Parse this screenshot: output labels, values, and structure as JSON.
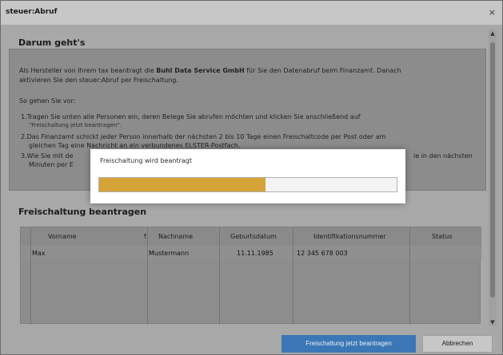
{
  "window": {
    "title": "steuer:Abruf",
    "close_glyph": "×"
  },
  "intro": {
    "heading": "Darum geht's",
    "paragraph_pre": "Als Hersteller von Ihrem tax beantragt die ",
    "paragraph_bold": "Buhl Data Service GmbH",
    "paragraph_post": " für Sie den Datenabruf beim Finanzamt. Danach",
    "paragraph_line2": "aktivieren Sie den steuer:Abruf per Freischaltung.",
    "steps_intro": "So gehen Sie vor:",
    "step1_l1": "1.Tragen Sie unten alle Personen ein, deren Belege Sie abrufen möchten und klicken Sie anschließend auf",
    "step1_l2": "\"Freischaltung jetzt beantragen\".",
    "step2_l1": "2.Das Finanzamt schickt jeder Person innerhalb der nächsten 2 bis 10 Tage einen Freischaltcode per Post oder am",
    "step2_l2": "gleichen Tag eine Nachricht an ein verbundenes ELSTER-Postfach.",
    "step3_l1_left": "3.Wie Sie mit de",
    "step3_l1_right": "ie in den nächsten",
    "step3_l2_left": "Minuten per E"
  },
  "request": {
    "heading": "Freischaltung beantragen",
    "columns": [
      "Vorname",
      "Nachname",
      "Geburtsdatum",
      "Identifikationsnummer",
      "Status"
    ],
    "sort_glyph": "↑",
    "rows": [
      {
        "vorname": "Max",
        "nachname": "Mustermann",
        "geburtsdatum": "11.11.1985",
        "id": "12 345 678 003",
        "status": ""
      }
    ]
  },
  "modal": {
    "title": "Freischaltung wird beantragt",
    "progress": 0.56
  },
  "buttons": {
    "primary": "Freischaltung jetzt beantragen",
    "cancel": "Abbrechen"
  },
  "colors": {
    "accent": "#3b77b6",
    "progress": "#d6a339"
  }
}
